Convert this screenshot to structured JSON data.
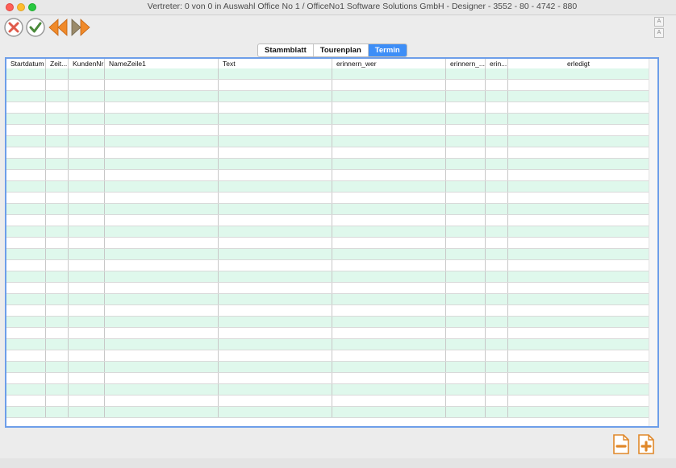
{
  "window": {
    "title": "Vertreter: 0 von 0 in Auswahl Office No 1 /  OfficeNo1 Software Solutions GmbH - Designer - 3552 - 80 - 4742 - 880"
  },
  "toolbar": {
    "buttons": [
      {
        "name": "cancel-button",
        "icon": "x-circle-icon",
        "color": "#e05a4a"
      },
      {
        "name": "confirm-button",
        "icon": "check-circle-icon",
        "color": "#4a8a3a"
      },
      {
        "name": "previous-button",
        "icon": "double-left-arrow-icon",
        "color": "#f08a2a"
      },
      {
        "name": "next-button",
        "icon": "double-right-arrow-icon",
        "color": "#9a8a6a"
      }
    ]
  },
  "tabs": [
    {
      "label": "Stammblatt",
      "active": false
    },
    {
      "label": "Tourenplan",
      "active": false
    },
    {
      "label": "Termin",
      "active": true
    }
  ],
  "grid": {
    "columns": [
      {
        "label": "Startdatum"
      },
      {
        "label": "Zeit..."
      },
      {
        "label": "KundenNr"
      },
      {
        "label": "NameZeile1"
      },
      {
        "label": "Text"
      },
      {
        "label": "erinnern_wer"
      },
      {
        "label": "erinnern_..."
      },
      {
        "label": "erin..."
      },
      {
        "label": "erledigt"
      }
    ],
    "row_count": 31,
    "stripe_color": "#dff8ec",
    "frame_color": "#6d9ee9"
  },
  "footer": {
    "buttons": [
      {
        "name": "remove-record-button",
        "icon": "document-minus-icon"
      },
      {
        "name": "add-record-button",
        "icon": "document-plus-icon"
      }
    ]
  }
}
